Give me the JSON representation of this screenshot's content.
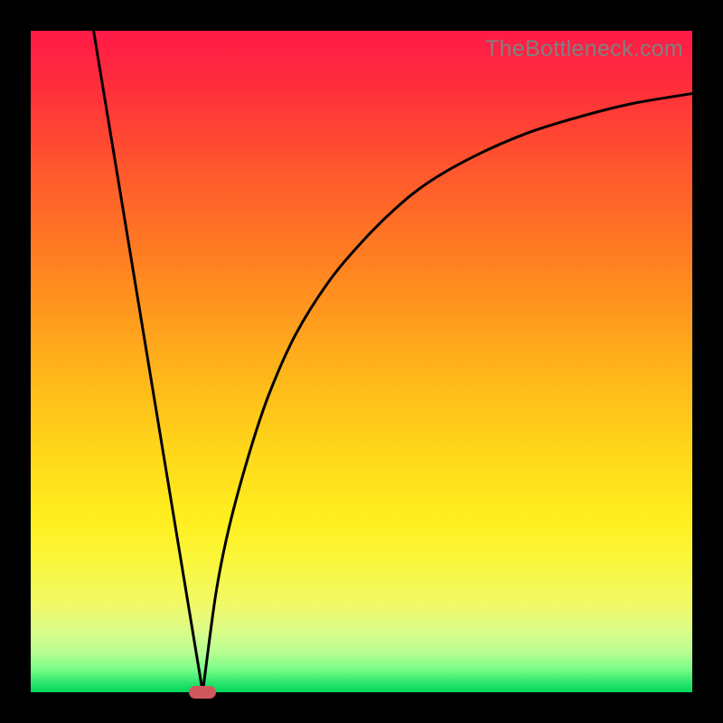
{
  "watermark": "TheBottleneck.com",
  "chart_data": {
    "type": "line",
    "title": "",
    "xlabel": "",
    "ylabel": "",
    "xlim": [
      0,
      100
    ],
    "ylim": [
      0,
      100
    ],
    "series": [
      {
        "name": "left-branch",
        "x": [
          9.5,
          26
        ],
        "y": [
          100,
          0
        ]
      },
      {
        "name": "right-branch",
        "x": [
          26,
          28,
          30,
          33,
          36,
          40,
          45,
          50,
          55,
          60,
          67,
          75,
          83,
          91,
          100
        ],
        "y": [
          0,
          15,
          25,
          36,
          45,
          54,
          62,
          68,
          73,
          77,
          81,
          84.5,
          87,
          89,
          90.5
        ]
      }
    ],
    "marker": {
      "x": 26,
      "y": 0,
      "color": "#cf585f"
    },
    "gradient_stops": [
      {
        "pos": 0,
        "color": "#ff1a47"
      },
      {
        "pos": 50,
        "color": "#ffd81a"
      },
      {
        "pos": 80,
        "color": "#faf63a"
      },
      {
        "pos": 100,
        "color": "#00d65a"
      }
    ]
  }
}
